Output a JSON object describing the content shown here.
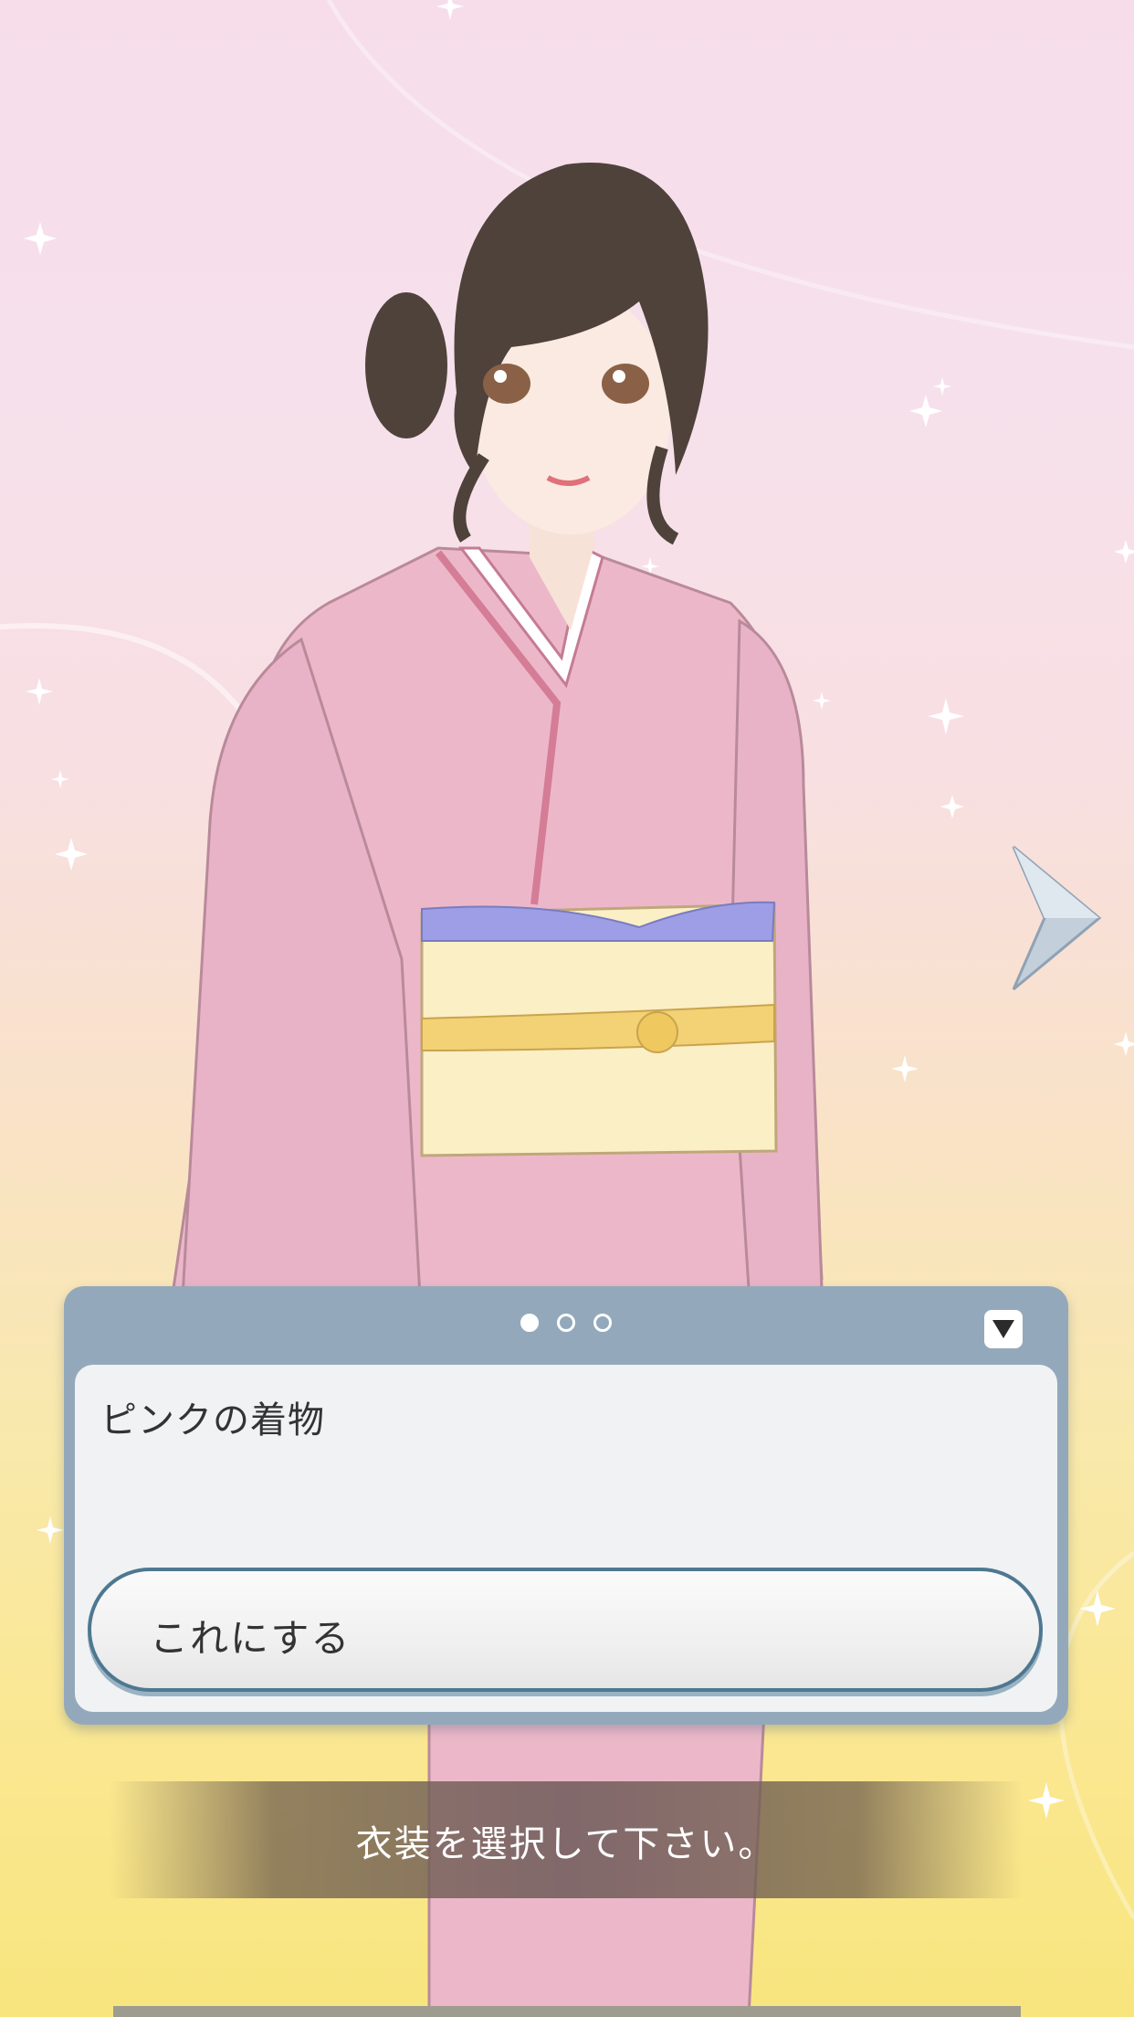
{
  "dialog": {
    "pages_total": 3,
    "current_page": 1,
    "outfit_name": "ピンクの着物",
    "confirm_label": "これにする"
  },
  "instruction": "衣装を選択して下さい。",
  "character": {
    "description_icon": "character-illustration"
  },
  "colors": {
    "dialog_frame": "#93a9bb",
    "button_border": "#4e7891",
    "kimono": "#ecb8c9",
    "obi": "#fbefc6",
    "obi_top": "#9d9ee6",
    "hair": "#4e423b"
  }
}
